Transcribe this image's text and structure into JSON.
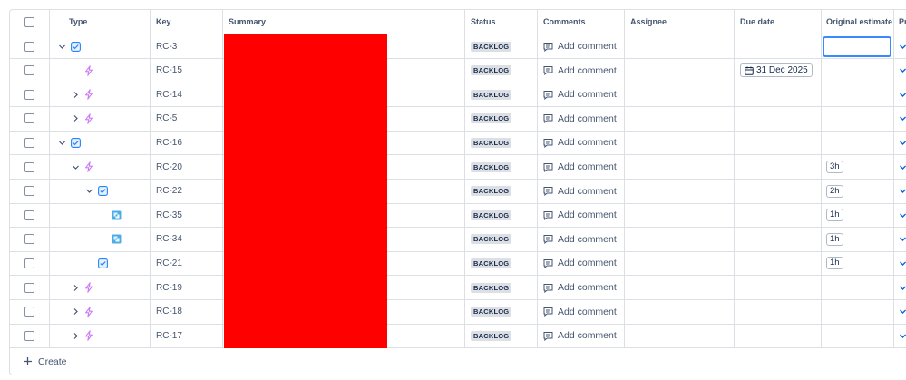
{
  "columns": {
    "type": "Type",
    "key": "Key",
    "summary": "Summary",
    "status": "Status",
    "comments": "Comments",
    "assignee": "Assignee",
    "due_date": "Due date",
    "original_estimate": "Original estimate",
    "priority": "Pr"
  },
  "add_comment_label": "Add comment",
  "create_label": "Create",
  "colors": {
    "epic_icon": "#2684ff",
    "subtask_icon": "#c97cf4",
    "story_icon": "#4bade8",
    "redaction": "#ff0000",
    "focus_border": "#388bff"
  },
  "rows": [
    {
      "key": "RC-3",
      "status": "BACKLOG",
      "icon": "checkbox-type-icon",
      "chevron": "chevron-down-icon",
      "due": "",
      "estimate": "",
      "estimate_focused": true
    },
    {
      "key": "RC-15",
      "status": "BACKLOG",
      "icon": "lightning-subtask-icon",
      "chevron": "",
      "due": "31 Dec 2025",
      "estimate": ""
    },
    {
      "key": "RC-14",
      "status": "BACKLOG",
      "icon": "lightning-subtask-icon",
      "chevron": "chevron-right-icon",
      "due": "",
      "estimate": ""
    },
    {
      "key": "RC-5",
      "status": "BACKLOG",
      "icon": "lightning-subtask-icon",
      "chevron": "chevron-right-icon",
      "due": "",
      "estimate": ""
    },
    {
      "key": "RC-16",
      "status": "BACKLOG",
      "icon": "checkbox-type-icon",
      "chevron": "chevron-down-icon",
      "due": "",
      "estimate": ""
    },
    {
      "key": "RC-20",
      "status": "BACKLOG",
      "icon": "lightning-subtask-icon",
      "chevron": "chevron-down-icon",
      "due": "",
      "estimate": "3h"
    },
    {
      "key": "RC-22",
      "status": "BACKLOG",
      "icon": "checkbox-type-icon",
      "chevron": "chevron-down-icon",
      "due": "",
      "estimate": "2h"
    },
    {
      "key": "RC-35",
      "status": "BACKLOG",
      "icon": "story-square-icon",
      "chevron": "",
      "due": "",
      "estimate": "1h"
    },
    {
      "key": "RC-34",
      "status": "BACKLOG",
      "icon": "story-square-icon",
      "chevron": "",
      "due": "",
      "estimate": "1h"
    },
    {
      "key": "RC-21",
      "status": "BACKLOG",
      "icon": "checkbox-type-icon",
      "chevron": "",
      "due": "",
      "estimate": "1h"
    },
    {
      "key": "RC-19",
      "status": "BACKLOG",
      "icon": "lightning-subtask-icon",
      "chevron": "chevron-right-icon",
      "due": "",
      "estimate": ""
    },
    {
      "key": "RC-18",
      "status": "BACKLOG",
      "icon": "lightning-subtask-icon",
      "chevron": "chevron-right-icon",
      "due": "",
      "estimate": ""
    },
    {
      "key": "RC-17",
      "status": "BACKLOG",
      "icon": "lightning-subtask-icon",
      "chevron": "chevron-right-icon",
      "due": "",
      "estimate": ""
    }
  ]
}
